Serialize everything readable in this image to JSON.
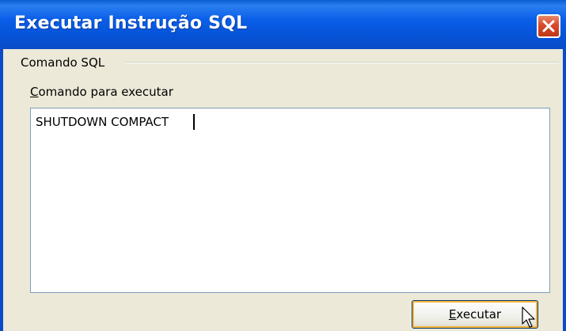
{
  "window": {
    "title": "Executar Instrução SQL",
    "title_bar_color": "#0a5ee8",
    "close_icon": "close-icon"
  },
  "group": {
    "label": "Comando SQL"
  },
  "command_field": {
    "label_mnemonic": "C",
    "label_rest": "omando para executar",
    "value": "SHUTDOWN COMPACT"
  },
  "execute_button": {
    "label_mnemonic": "E",
    "label_rest": "xecutar",
    "focus_color": "#f8b33a"
  }
}
